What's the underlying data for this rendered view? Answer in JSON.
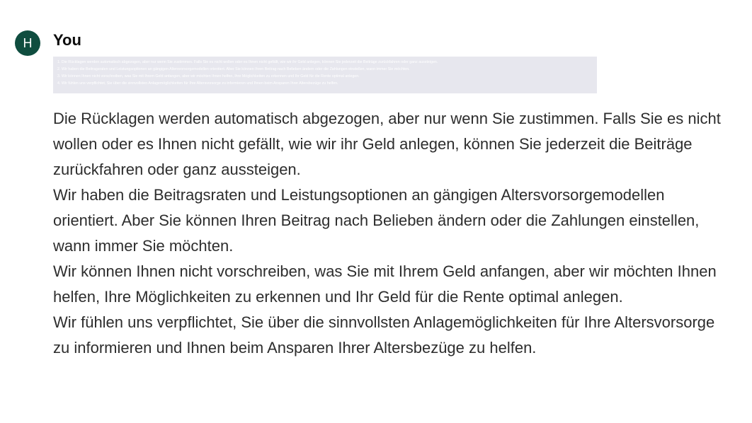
{
  "message": {
    "avatar_letter": "H",
    "avatar_color": "#0f4d3f",
    "author": "You",
    "attached_image_lines": [
      "1.   Die Rücklagen werden automatisch abgezogen, aber nur wenn Sie zustimmen. Falls Sie es nicht wollen oder es Ihnen nicht gefällt, wie wir ihr Geld anlegen, können Sie jederzeit die Beiträge zurückfahren oder ganz aussteigen.",
      "2.   Wir haben die Beitragsraten und Leistungsoptionen an gängigen Altersvorsorgemodellen orientiert. Aber Sie können Ihren Beitrag nach Belieben ändern oder die Zahlungen einstellen, wann immer Sie möchten.",
      "3.   Wir können Ihnen nicht vorschreiben, was Sie mit Ihrem Geld anfangen, aber wir möchten Ihnen helfen, Ihre Möglichkeiten zu erkennen und Ihr Geld für die Rente optimal anlegen.",
      "4.   Wir fühlen uns verpflichtet, Sie über die sinnvollsten Anlagemöglichkeiten für Ihre Altersvorsorge zu informieren und Ihnen beim Ansparen Ihrer Altersbezüge zu helfen."
    ],
    "paragraphs": [
      "Die Rücklagen werden automatisch abgezogen, aber nur wenn Sie zustimmen. Falls Sie es nicht wollen oder es Ihnen nicht gefällt, wie wir ihr Geld anlegen, können Sie jederzeit die Beiträge zurückfahren oder ganz aussteigen.",
      "Wir haben die Beitragsraten und Leistungsoptionen an gängigen Altersvorsorgemodellen orientiert. Aber Sie können Ihren Beitrag nach Belieben ändern oder die Zahlungen einstellen, wann immer Sie möchten.",
      "Wir können Ihnen nicht vorschreiben, was Sie mit Ihrem Geld anfangen, aber wir möchten Ihnen helfen, Ihre Möglichkeiten zu erkennen und Ihr Geld für die Rente optimal anlegen.",
      "Wir fühlen uns verpflichtet, Sie über die sinnvollsten Anlagemöglichkeiten für Ihre Altersvorsorge zu informieren und Ihnen beim Ansparen Ihrer Altersbezüge zu helfen."
    ]
  }
}
